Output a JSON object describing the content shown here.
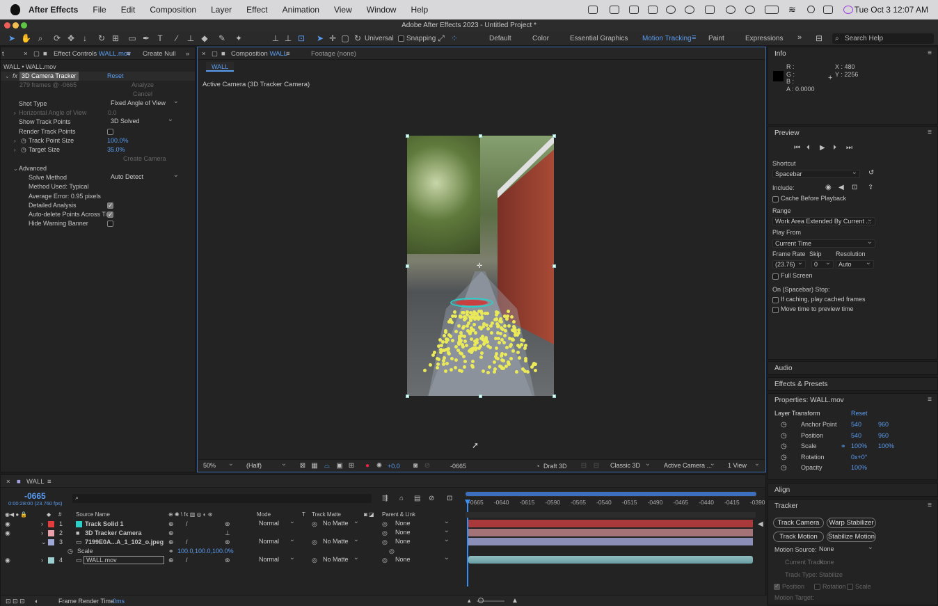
{
  "menubar": {
    "app": "After Effects",
    "items": [
      "File",
      "Edit",
      "Composition",
      "Layer",
      "Effect",
      "Animation",
      "View",
      "Window",
      "Help"
    ],
    "datetime": "Tue Oct 3  12:07 AM"
  },
  "window_title": "Adobe After Effects 2023 - Untitled Project *",
  "toolbar": {
    "universal": "Universal",
    "snapping": "Snapping",
    "workspaces": [
      "Default",
      "Color",
      "Essential Graphics",
      "Motion Tracking",
      "Paint",
      "Expressions"
    ],
    "active_workspace": "Motion Tracking",
    "search_placeholder": "Search Help"
  },
  "effect_panel": {
    "tab_left": "t",
    "tab_label": "Effect Controls",
    "tab_layer": "WALL.mov",
    "tab_create_null": "Create Null",
    "breadcrumb": "WALL • WALL.mov",
    "effect_name": "3D Camera Tracker",
    "reset": "Reset",
    "frames_info": "279 frames @ -0665",
    "analyze": "Analyze",
    "cancel": "Cancel",
    "shot_type_label": "Shot Type",
    "shot_type_value": "Fixed Angle of View",
    "hfov_label": "Horizontal Angle of View",
    "hfov_value": "0.0",
    "show_tp_label": "Show Track Points",
    "show_tp_value": "3D Solved",
    "render_tp_label": "Render Track Points",
    "tp_size_label": "Track Point Size",
    "tp_size_value": "100.0%",
    "target_size_label": "Target Size",
    "target_size_value": "35.0%",
    "create_camera": "Create Camera",
    "advanced_label": "Advanced",
    "solve_method_label": "Solve Method",
    "solve_method_value": "Auto Detect",
    "method_used": "Method Used: Typical",
    "avg_error": "Average Error: 0.95 pixels",
    "detailed_analysis": "Detailed Analysis",
    "auto_delete": "Auto-delete Points Across Ti",
    "hide_warning": "Hide Warning Banner"
  },
  "composition_panel": {
    "tab_label": "Composition",
    "tab_comp": "WALL",
    "footage_tab": "Footage (none)",
    "comp_chip": "WALL",
    "camera_label": "Active Camera (3D Tracker Camera)",
    "zoom": "50%",
    "resolution": "(Half)",
    "exposure": "+0.0",
    "timecode": "-0665",
    "draft3d": "Draft 3D",
    "renderer": "Classic 3D",
    "camera": "Active Camera ...",
    "views": "1 View"
  },
  "info_panel": {
    "title": "Info",
    "r": "R :",
    "g": "G :",
    "b": "B :",
    "a": "A : 0.0000",
    "x": "X : 480",
    "y": "Y : 2256"
  },
  "preview_panel": {
    "title": "Preview",
    "shortcut_label": "Shortcut",
    "shortcut_value": "Spacebar",
    "include_label": "Include:",
    "cache_before": "Cache Before Playback",
    "range_label": "Range",
    "range_value": "Work Area Extended By Current ...",
    "play_from_label": "Play From",
    "play_from_value": "Current Time",
    "frame_rate_label": "Frame Rate",
    "skip_label": "Skip",
    "resolution_label": "Resolution",
    "frame_rate_value": "(23.76)",
    "skip_value": "0",
    "resolution_value": "Auto",
    "full_screen": "Full Screen",
    "stop_label": "On (Spacebar) Stop:",
    "if_caching": "If caching, play cached frames",
    "move_time": "Move time to preview time"
  },
  "side_sections": {
    "audio": "Audio",
    "effects_presets": "Effects & Presets",
    "align": "Align"
  },
  "properties_panel": {
    "title": "Properties: WALL.mov",
    "layer_transform": "Layer Transform",
    "reset": "Reset",
    "props": [
      {
        "name": "Anchor Point",
        "v1": "540",
        "v2": "960"
      },
      {
        "name": "Position",
        "v1": "540",
        "v2": "960"
      },
      {
        "name": "Scale",
        "v1": "100%",
        "v2": "100%"
      },
      {
        "name": "Rotation",
        "v1": "0x+0°",
        "v2": ""
      },
      {
        "name": "Opacity",
        "v1": "100%",
        "v2": ""
      }
    ]
  },
  "tracker_panel": {
    "title": "Tracker",
    "track_camera": "Track Camera",
    "warp_stabilizer": "Warp Stabilizer",
    "track_motion": "Track Motion",
    "stabilize_motion": "Stabilize Motion",
    "motion_source_label": "Motion Source:",
    "motion_source_value": "None",
    "current_track_label": "Current Track:",
    "current_track_value": "None",
    "track_type_label": "Track Type:",
    "track_type_value": "Stabilize",
    "position": "Position",
    "rotation": "Rotation",
    "scale": "Scale",
    "motion_target": "Motion Target:"
  },
  "timeline": {
    "tab": "WALL",
    "timecode": "-0665",
    "timecode_sub": "0:00:28:00 (23.760 fps)",
    "col_source": "Source Name",
    "col_mode": "Mode",
    "col_t": "T",
    "col_track_matte": "Track Matte",
    "col_parent": "Parent & Link",
    "layers": [
      {
        "num": "1",
        "name": "Track Solid 1",
        "color": "#e23c3c",
        "swatch": "#2ad0c8",
        "mode": "Normal",
        "matte": "No Matte",
        "parent": "None"
      },
      {
        "num": "2",
        "name": "3D Tracker Camera",
        "color": "#e9a0aa",
        "swatch": "",
        "mode": "",
        "matte": "",
        "parent": "None"
      },
      {
        "num": "3",
        "name": "7199E0A...A_1_102_o.jpeg",
        "color": "#a0a8d8",
        "swatch": "",
        "mode": "Normal",
        "matte": "No Matte",
        "parent": "None"
      },
      {
        "num": "4",
        "name": "WALL.mov",
        "color": "#9cd0d0",
        "swatch": "",
        "mode": "Normal",
        "matte": "No Matte",
        "parent": "None"
      }
    ],
    "scale_label": "Scale",
    "scale_value": "100.0,100.0,100.0%",
    "ruler": [
      "-0665",
      "-0640",
      "-0615",
      "-0590",
      "-0565",
      "-0540",
      "-0515",
      "-0490",
      "-0465",
      "-0440",
      "-0415",
      "-0390"
    ],
    "render_time_label": "Frame Render Time",
    "render_time_value": "0ms"
  }
}
